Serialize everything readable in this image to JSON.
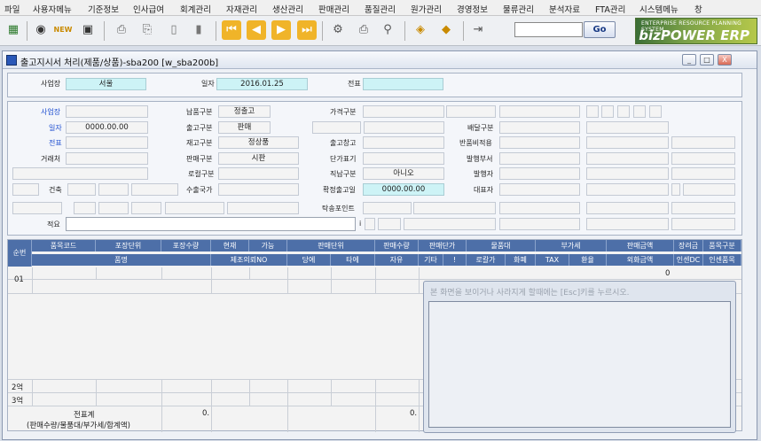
{
  "menu": [
    "파일",
    "사용자메뉴",
    "기준정보",
    "인사급여",
    "회계관리",
    "자재관리",
    "생산관리",
    "판매관리",
    "품질관리",
    "원가관리",
    "경영정보",
    "물류관리",
    "분석자료",
    "FTA관리",
    "시스템메뉴",
    "창"
  ],
  "toolbar": {
    "search_value": "",
    "go_label": "Go",
    "logo_top": "ENTERPRISE RESOURCE PLANNING SYSTEM",
    "logo_name": "bizPOWER ERP",
    "icons": [
      "program-icon",
      "view-icon",
      "new-icon",
      "save-icon",
      "print-preview-icon",
      "print-icon",
      "delete-icon",
      "clear-icon",
      "first-icon",
      "prev-icon",
      "next-icon",
      "last-icon",
      "settings-icon",
      "print-setup-icon",
      "search-icon",
      "excel-icon",
      "export-icon",
      "exit-icon"
    ]
  },
  "window": {
    "title": "출고지시서 처리(제품/상품)-sba200 [w_sba200b]",
    "min": "_",
    "max": "□",
    "close": "X"
  },
  "header": {
    "biz_label": "사업장",
    "biz_value": "서울",
    "date_label": "일자",
    "date_value": "2016.01.25",
    "slip_label": "전표",
    "slip_value": ""
  },
  "detail": {
    "col1": [
      {
        "label": "사업장",
        "value": ""
      },
      {
        "label": "일자",
        "value": "0000.00.00"
      },
      {
        "label": "전표",
        "value": ""
      },
      {
        "label": "거래처",
        "value": ""
      }
    ],
    "building_label": "건축",
    "col2": [
      {
        "label": "납품구분",
        "value": "정출고"
      },
      {
        "label": "출고구분",
        "value": "판매"
      },
      {
        "label": "재고구분",
        "value": "정상품"
      },
      {
        "label": "판매구분",
        "value": "시판"
      },
      {
        "label": "로컬구분",
        "value": ""
      },
      {
        "label": "수출국가",
        "value": ""
      }
    ],
    "col3": [
      {
        "label": "가격구분",
        "value": ""
      },
      {
        "label": "",
        "value": ""
      },
      {
        "label": "출고창고",
        "value": ""
      },
      {
        "label": "단가표기",
        "value": ""
      },
      {
        "label": "직납구분",
        "value": "아니오"
      },
      {
        "label": "확정출고일",
        "value": "0000.00.00"
      }
    ],
    "col4": [
      "",
      "배달구분",
      "반품비적용",
      "발행부서",
      "발행자",
      "대표자"
    ],
    "pickup_label": "탁송포인트",
    "note_label": "적요",
    "note_value": "",
    "note_mark": "i"
  },
  "grid": {
    "head1": [
      {
        "t": "순번"
      },
      {
        "t": "품목코드"
      },
      {
        "t": "포장단위"
      },
      {
        "t": "포장수량"
      },
      {
        "t": "현재"
      },
      {
        "t": "가능"
      },
      {
        "t": "판매단위"
      },
      {
        "t": "판매수량"
      },
      {
        "t": "판매단가"
      },
      {
        "t": "물품대"
      },
      {
        "t": "부가세"
      },
      {
        "t": "판매금액"
      },
      {
        "t": "장려금"
      },
      {
        "t": "품목구분"
      }
    ],
    "head2": [
      {
        "t": "품명"
      },
      {
        "t": "제조의뢰NO"
      },
      {
        "t": "당에"
      },
      {
        "t": "타에"
      },
      {
        "t": "자유"
      },
      {
        "t": "기타"
      },
      {
        "t": "!"
      },
      {
        "t": "로칼가"
      },
      {
        "t": "화폐"
      },
      {
        "t": "TAX"
      },
      {
        "t": "환율"
      },
      {
        "t": "외화금액"
      },
      {
        "t": "인센DC"
      },
      {
        "t": "인센품목"
      }
    ],
    "row1_no": "01",
    "row1_amount": "0",
    "row2_label": "2억",
    "row3_label": "3억",
    "total_label": "전표계",
    "total_sub": "(판매수량/물품대/부가세/합계액)",
    "total_qty": "0.",
    "total_amt": "0.",
    "total_sum": "0"
  },
  "popup": {
    "title": "본 화면을 보이거나 사라지게 할때에는 [Esc]키를 누르시오."
  }
}
